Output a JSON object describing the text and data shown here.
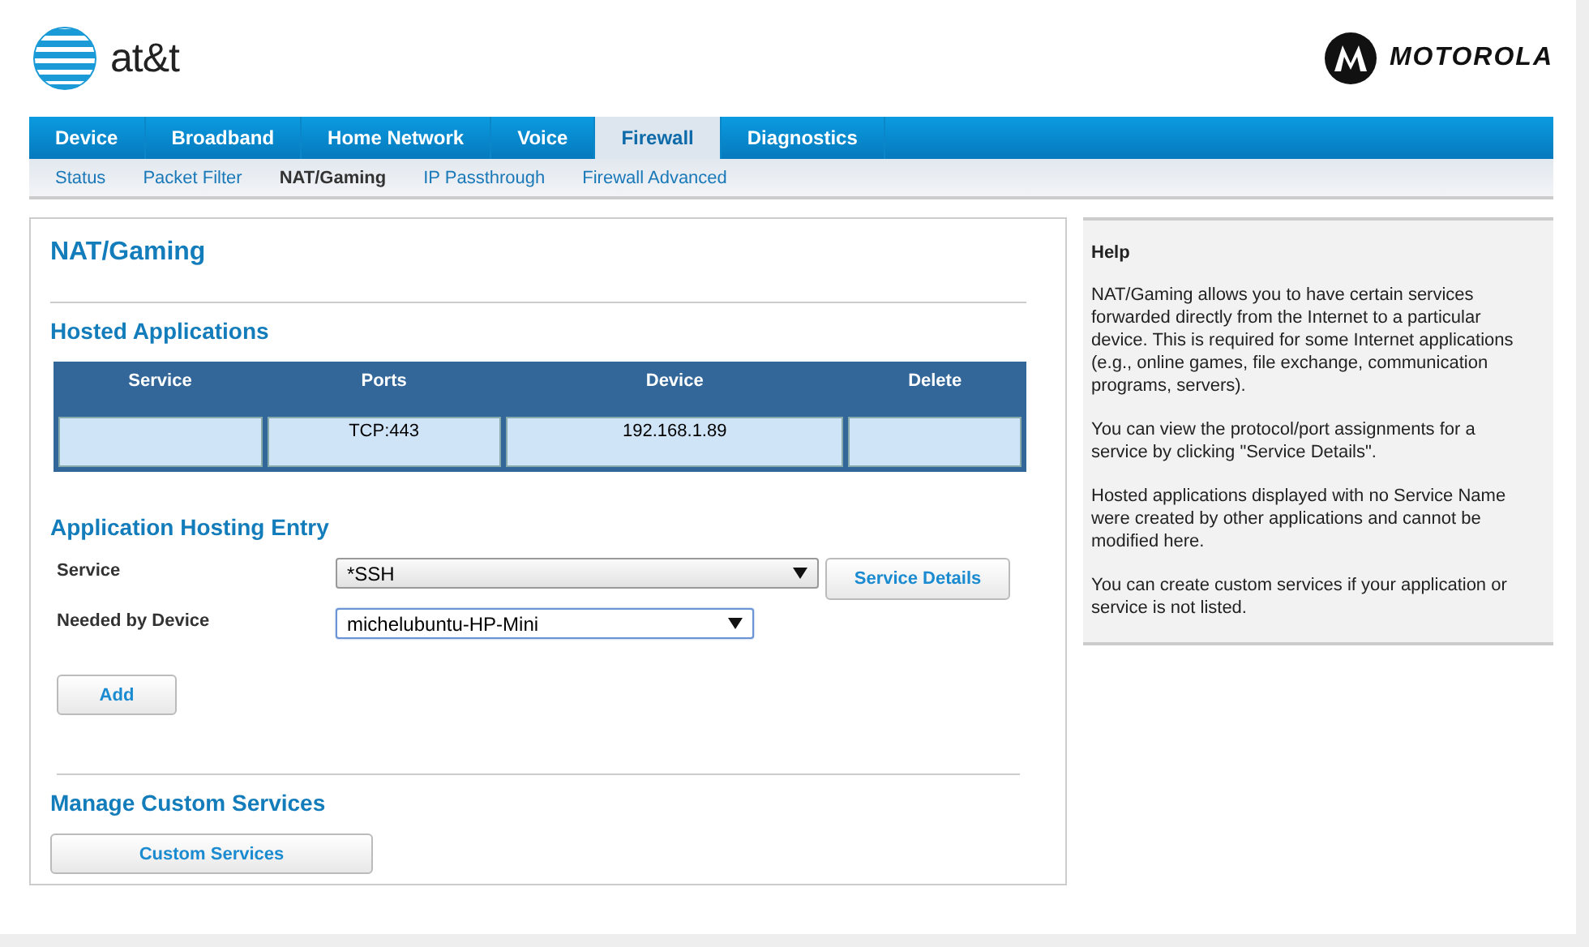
{
  "header": {
    "brand_left": "at&t",
    "brand_right": "MOTOROLA"
  },
  "tabs": [
    {
      "label": "Device",
      "selected": false
    },
    {
      "label": "Broadband",
      "selected": false
    },
    {
      "label": "Home Network",
      "selected": false
    },
    {
      "label": "Voice",
      "selected": false
    },
    {
      "label": "Firewall",
      "selected": true
    },
    {
      "label": "Diagnostics",
      "selected": false
    }
  ],
  "subtabs": [
    {
      "label": "Status",
      "selected": false
    },
    {
      "label": "Packet Filter",
      "selected": false
    },
    {
      "label": "NAT/Gaming",
      "selected": true
    },
    {
      "label": "IP Passthrough",
      "selected": false
    },
    {
      "label": "Firewall Advanced",
      "selected": false
    }
  ],
  "page_title": "NAT/Gaming",
  "hosted": {
    "title": "Hosted Applications",
    "columns": [
      "Service",
      "Ports",
      "Device",
      "Delete"
    ],
    "rows": [
      [
        "",
        "TCP:443",
        "192.168.1.89",
        ""
      ]
    ]
  },
  "entry": {
    "title": "Application Hosting Entry",
    "fields": [
      {
        "label": "Service",
        "value": "*SSH",
        "focused": false,
        "button": "Service Details"
      },
      {
        "label": "Needed by Device",
        "value": "michelubuntu-HP-Mini",
        "focused": true
      }
    ],
    "add_button": "Add"
  },
  "custom": {
    "title": "Manage Custom Services",
    "button": "Custom Services"
  },
  "help": {
    "title": "Help",
    "paragraphs": [
      "NAT/Gaming allows you to have certain services forwarded directly from the Internet to a particular device. This is required for some Internet applications (e.g., online games, file exchange, communication programs, servers).",
      "You can view the protocol/port assignments for a service by clicking \"Service Details\".",
      "Hosted applications displayed with no Service Name were created by other applications and cannot be modified here.",
      "You can create custom services if your application or service is not listed."
    ]
  }
}
